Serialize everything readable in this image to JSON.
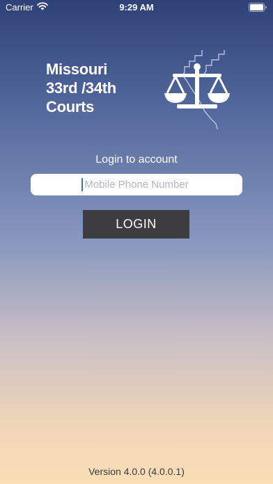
{
  "status_bar": {
    "carrier": "Carrier",
    "time": "9:29 AM"
  },
  "brand": {
    "line1": "Missouri",
    "line2": "33rd /34th",
    "line3": "Courts",
    "logo_icon": "scales-of-justice-icon"
  },
  "login": {
    "prompt": "Login to account",
    "phone_placeholder": "Mobile Phone Number",
    "phone_value": "",
    "button_label": "LOGIN"
  },
  "footer": {
    "version": "Version 4.0.0 (4.0.0.1)"
  },
  "colors": {
    "gradient_top": "#2e4277",
    "gradient_bottom": "#f9dfb5",
    "button_bg": "#3d3d3f",
    "caret": "#3b6fd6"
  }
}
